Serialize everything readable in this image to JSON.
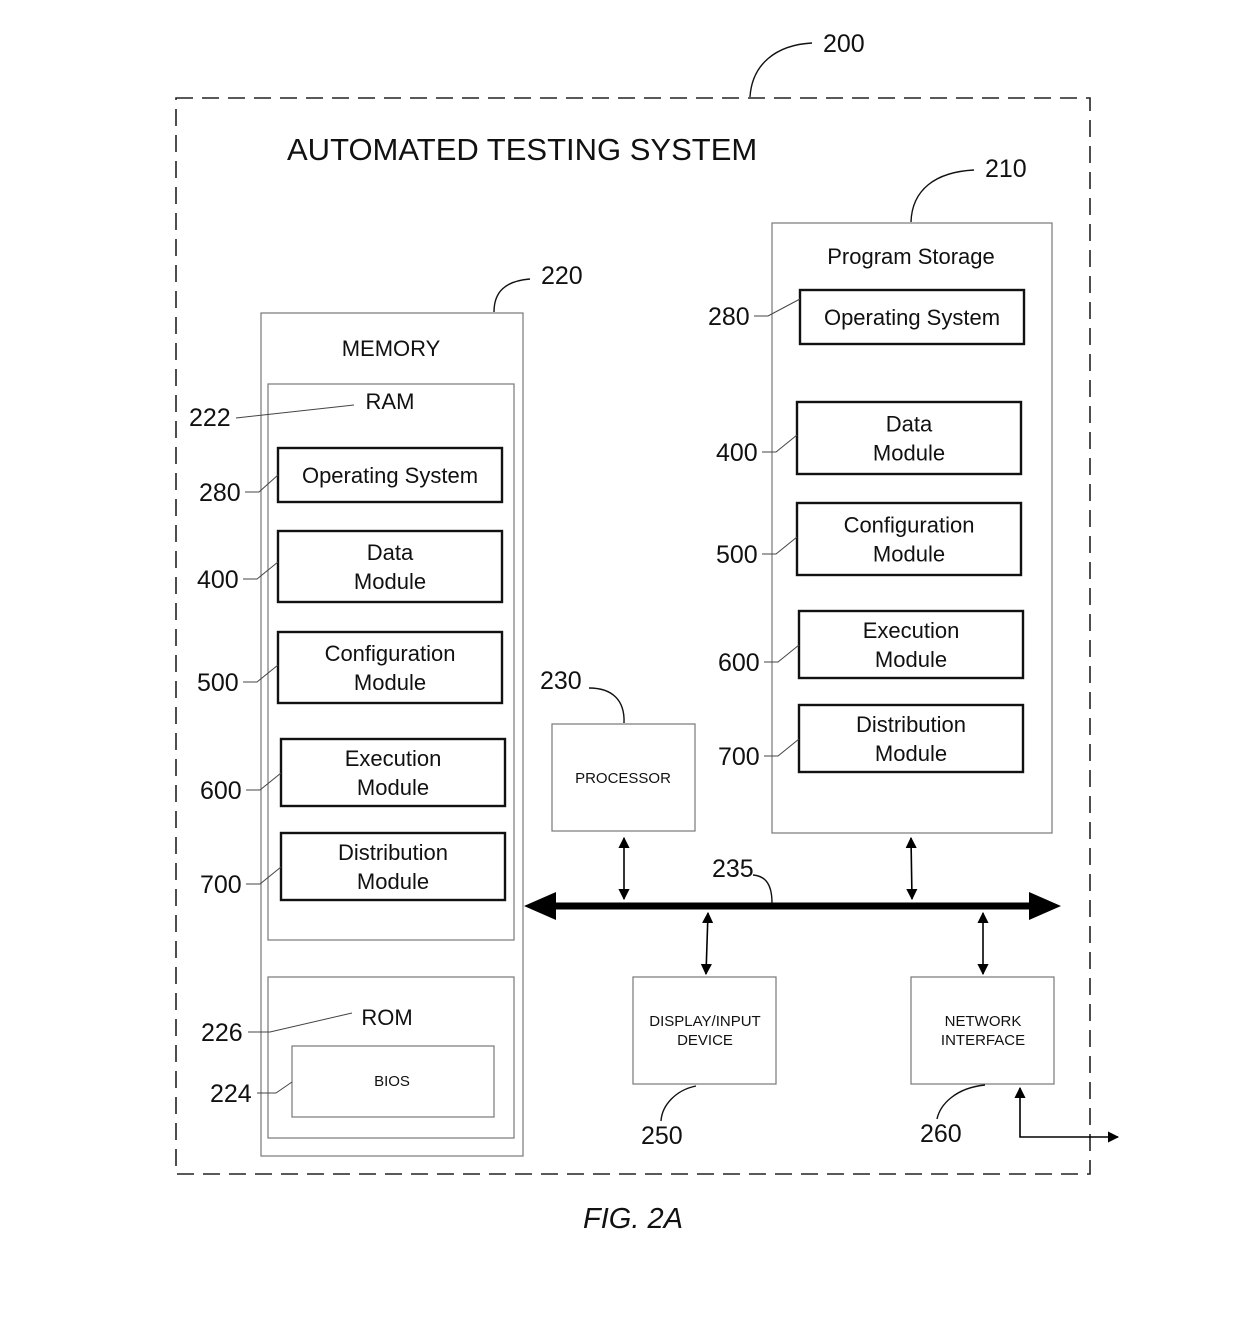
{
  "system": {
    "ref": "200",
    "title": "AUTOMATED TESTING SYSTEM"
  },
  "memory": {
    "ref": "220",
    "label": "MEMORY",
    "ram": {
      "ref": "222",
      "label": "RAM",
      "modules": [
        {
          "ref": "280",
          "lines": [
            "Operating System"
          ]
        },
        {
          "ref": "400",
          "lines": [
            "Data",
            "Module"
          ]
        },
        {
          "ref": "500",
          "lines": [
            "Configuration",
            "Module"
          ]
        },
        {
          "ref": "600",
          "lines": [
            "Execution",
            "Module"
          ]
        },
        {
          "ref": "700",
          "lines": [
            "Distribution",
            "Module"
          ]
        }
      ]
    },
    "rom": {
      "ref": "226",
      "label": "ROM",
      "bios": {
        "ref": "224",
        "label": "BIOS"
      }
    }
  },
  "program_storage": {
    "ref": "210",
    "label": "Program Storage",
    "modules": [
      {
        "ref": "280",
        "lines": [
          "Operating System"
        ]
      },
      {
        "ref": "400",
        "lines": [
          "Data",
          "Module"
        ]
      },
      {
        "ref": "500",
        "lines": [
          "Configuration",
          "Module"
        ]
      },
      {
        "ref": "600",
        "lines": [
          "Execution",
          "Module"
        ]
      },
      {
        "ref": "700",
        "lines": [
          "Distribution",
          "Module"
        ]
      }
    ]
  },
  "processor": {
    "ref": "230",
    "label": "PROCESSOR"
  },
  "bus": {
    "ref": "235"
  },
  "display_input": {
    "ref": "250",
    "lines": [
      "DISPLAY/INPUT",
      "DEVICE"
    ]
  },
  "network_interface": {
    "ref": "260",
    "lines": [
      "NETWORK",
      "INTERFACE"
    ]
  },
  "caption": "FIG. 2A"
}
